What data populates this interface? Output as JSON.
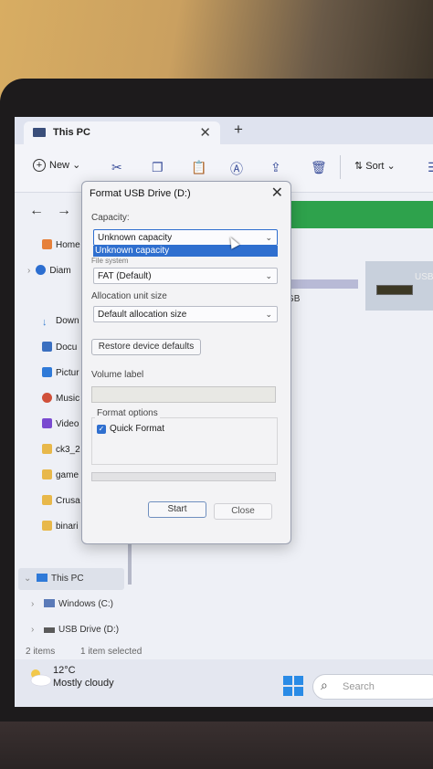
{
  "explorer": {
    "tab_title": "This PC",
    "tab_close": "✕",
    "new_tab": "+",
    "new_label": "New",
    "sort_label": "Sort",
    "sidebar": [
      {
        "label": "Home",
        "color": "#e6803a"
      },
      {
        "label": "Diam",
        "color": "#2c6ed0"
      },
      {
        "label": "Down",
        "color": "#3a7fd0"
      },
      {
        "label": "Docu",
        "color": "#3a6fc0"
      },
      {
        "label": "Pictur",
        "color": "#2f7ad8"
      },
      {
        "label": "Music",
        "color": "#d0503a"
      },
      {
        "label": "Video",
        "color": "#7a4ad0"
      },
      {
        "label": "ck3_2",
        "color": "#e8b84a"
      },
      {
        "label": "game",
        "color": "#e8b84a"
      },
      {
        "label": "Crusa",
        "color": "#e8b84a"
      },
      {
        "label": "binari",
        "color": "#e8b84a"
      }
    ],
    "tree": {
      "this_pc": "This PC",
      "windows_c": "Windows (C:)",
      "usb_d": "USB Drive (D:)"
    },
    "content": {
      "gb_label": "GB",
      "tile_caption": "USB"
    },
    "status": {
      "items": "2 items",
      "selected": "1 item selected"
    }
  },
  "taskbar": {
    "temperature": "12°C",
    "condition": "Mostly cloudy",
    "search_placeholder": "Search"
  },
  "dialog": {
    "title": "Format USB Drive (D:)",
    "close": "✕",
    "capacity_label": "Capacity:",
    "capacity_value": "Unknown capacity",
    "capacity_option": "Unknown capacity",
    "filesystem_label": "File system",
    "filesystem_value": "FAT (Default)",
    "allocation_label": "Allocation unit size",
    "allocation_value": "Default allocation size",
    "restore_label": "Restore device defaults",
    "volume_label": "Volume label",
    "volume_value": "",
    "format_options_label": "Format options",
    "quick_format_label": "Quick Format",
    "quick_format_checked": true,
    "start_label": "Start",
    "close_label": "Close"
  }
}
